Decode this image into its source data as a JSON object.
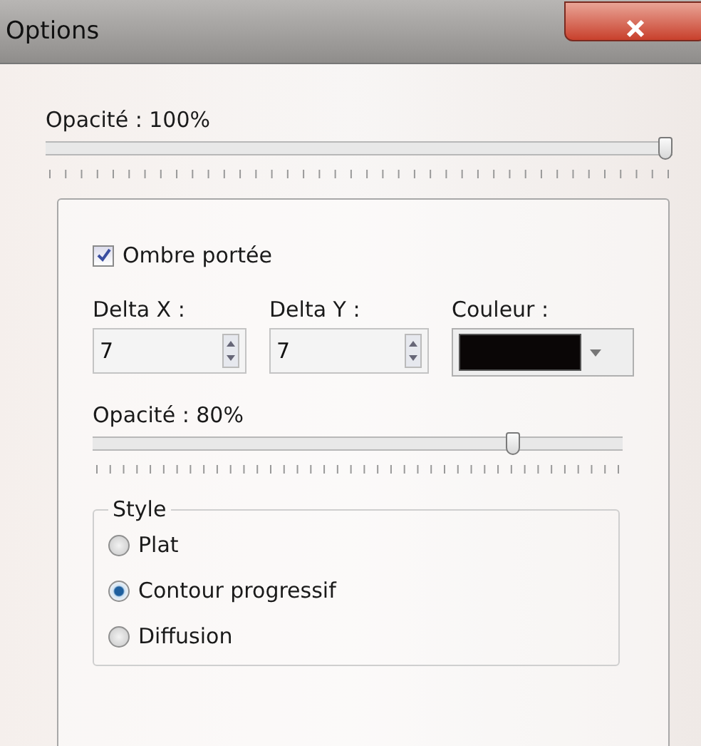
{
  "window": {
    "title": "Options"
  },
  "opacity": {
    "label": "Opacité : 100%",
    "level": 1.0
  },
  "shadow": {
    "checkbox": {
      "label": "Ombre portée",
      "checked": true
    },
    "delta_x": {
      "label": "Delta X :",
      "value": "7"
    },
    "delta_y": {
      "label": "Delta Y :",
      "value": "7"
    },
    "color": {
      "label": "Couleur :",
      "color": "#0a0606"
    },
    "opacity": {
      "label": "Opacité : 80%",
      "level": 0.8
    },
    "style": {
      "title": "Style",
      "options": [
        {
          "label": "Plat",
          "selected": false
        },
        {
          "label": "Contour progressif",
          "selected": true
        },
        {
          "label": "Diffusion",
          "selected": false
        }
      ]
    }
  }
}
